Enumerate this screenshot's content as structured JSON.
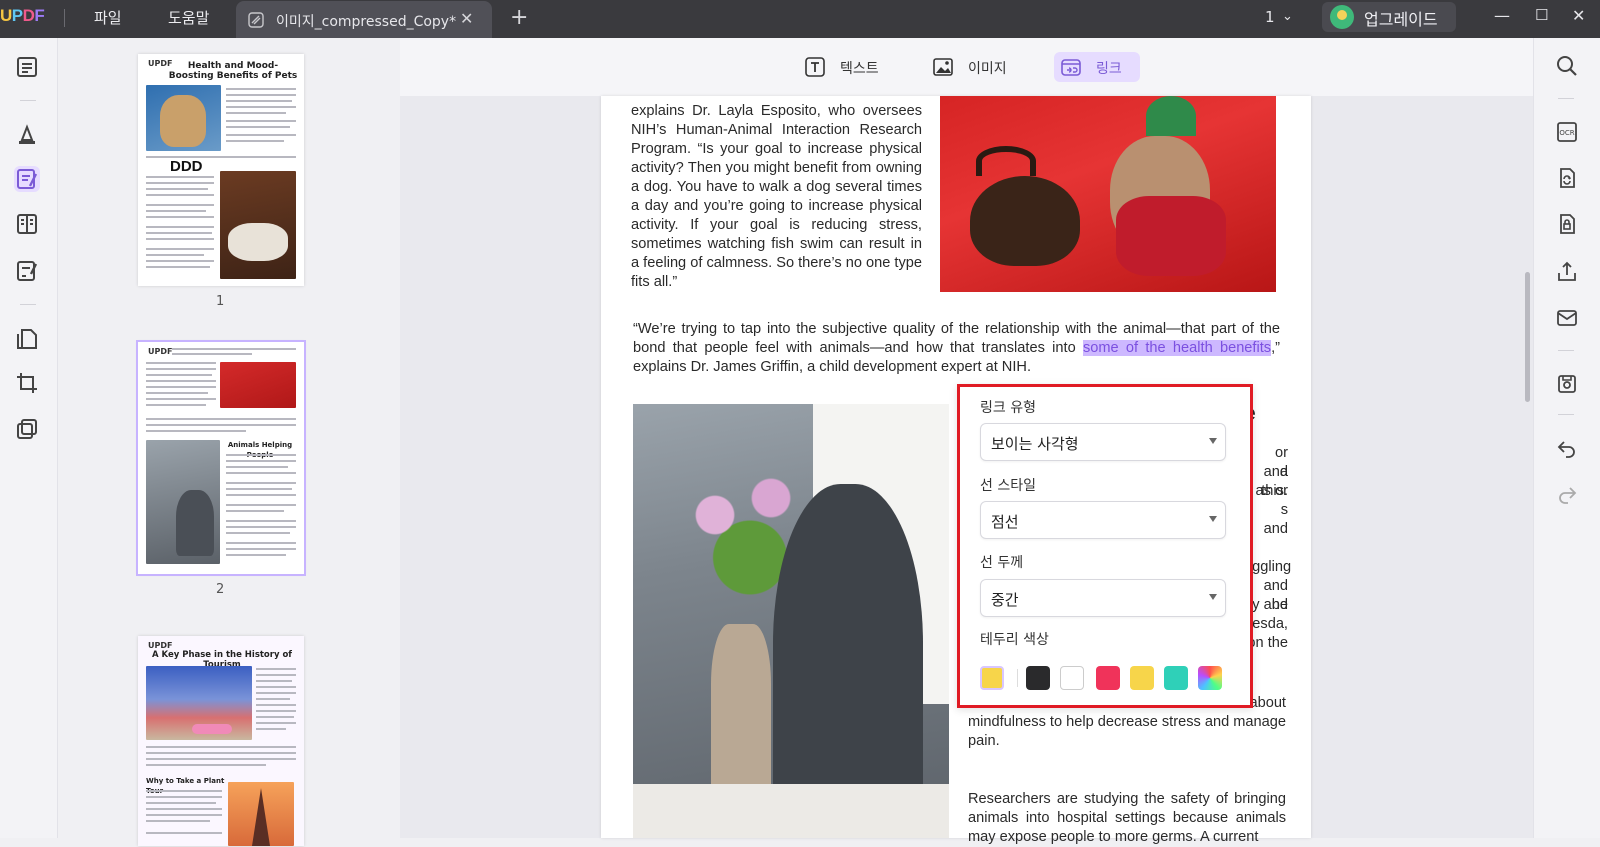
{
  "titlebar": {
    "logo": "UPDF",
    "menu": [
      "파일",
      "도움말"
    ],
    "tab_title": "이미지_compressed_Copy*",
    "page_indicator": "1",
    "upgrade_label": "업그레이드"
  },
  "left_rail": {
    "icons": [
      "reader-icon",
      "comment-icon",
      "edit-pdf-icon",
      "organize-icon",
      "form-icon",
      "convert-icon",
      "crop-icon",
      "layers-icon"
    ]
  },
  "thumbnails": [
    {
      "page_label": "1",
      "title": "Health and Mood-Boosting Benefits of Pets",
      "overlay_text": "DDD"
    },
    {
      "page_label": "2",
      "title": "Animals Helping People"
    },
    {
      "page_label": "",
      "title": "A Key Phase in the History of Tourism",
      "subheading": "Why to Take a Plant Tour"
    }
  ],
  "toolbar": {
    "text_label": "텍스트",
    "image_label": "이미지",
    "link_label": "링크"
  },
  "document": {
    "para1": "explains Dr. Layla Esposito, who oversees NIH’s Human-Animal Interaction Research Program. “Is your goal to increase physical activity? Then you might benefit from owning a dog. You have to walk a dog several times a day and you’re going to increase physical activity. If your goal is reducing stress, sometimes watching fish swim can result in a feeling of calmness. So there’s no one type fits all.”",
    "para2_before": "“We’re trying to tap into the subjective quality of the relationship with the animal—that part of the bond that people feel with animals—and how that translates into ",
    "para2_link": "some of the health benefits",
    "para2_after": ",” explains Dr. James Griffin, a child development expert at NIH.",
    "heading_fragment": "e",
    "right_col_fragments": [
      "or and",
      "a this.",
      "as or",
      "s and",
      "uggling",
      "and be",
      "y and",
      "hesda,",
      "on the"
    ],
    "para3": "and terminal illnesses. She teaches them about mindfulness to help decrease stress and manage pain.",
    "para4": "Researchers are studying the safety of bringing animals into hospital settings because animals may expose people to more germs. A current"
  },
  "link_popup": {
    "link_type_label": "링크 유형",
    "link_type_value": "보이는 사각형",
    "line_style_label": "선 스타일",
    "line_style_value": "점선",
    "line_width_label": "선 두께",
    "line_width_value": "중간",
    "border_color_label": "테두리 색상",
    "current_color": "#f7d54a",
    "colors": [
      "#2a2a2c",
      "#ffffff",
      "#f0335a",
      "#f7d54a",
      "#2fd0b8",
      "rainbow"
    ]
  }
}
